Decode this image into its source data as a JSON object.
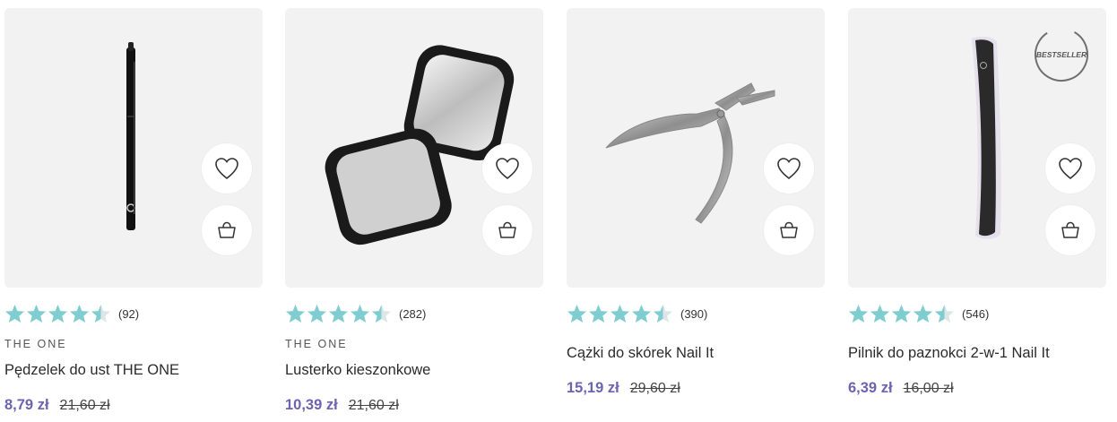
{
  "colors": {
    "accent": "#6b64b0",
    "star": "#7fcdd0",
    "background": "#f2f2f3"
  },
  "products": [
    {
      "rating_count": "(92)",
      "rating": 4.5,
      "brand": "THE ONE",
      "name": "Pędzelek do ust THE ONE",
      "price": "8,79 zł",
      "old_price": "21,60 zł",
      "wishlist_icon": "heart-icon",
      "cart_icon": "shopping-bag-icon"
    },
    {
      "rating_count": "(282)",
      "rating": 4.5,
      "brand": "THE ONE",
      "name": "Lusterko kieszonkowe",
      "price": "10,39 zł",
      "old_price": "21,60 zł",
      "wishlist_icon": "heart-icon",
      "cart_icon": "shopping-bag-icon"
    },
    {
      "rating_count": "(390)",
      "rating": 4.5,
      "brand": "",
      "name": "Cążki do skórek Nail It",
      "price": "15,19 zł",
      "old_price": "29,60 zł",
      "wishlist_icon": "heart-icon",
      "cart_icon": "shopping-bag-icon"
    },
    {
      "rating_count": "(546)",
      "rating": 4.5,
      "brand": "",
      "badge": "BESTSELLER",
      "name": "Pilnik do paznokci 2-w-1 Nail It",
      "price": "6,39 zł",
      "old_price": "16,00 zł",
      "wishlist_icon": "heart-icon",
      "cart_icon": "shopping-bag-icon"
    }
  ]
}
